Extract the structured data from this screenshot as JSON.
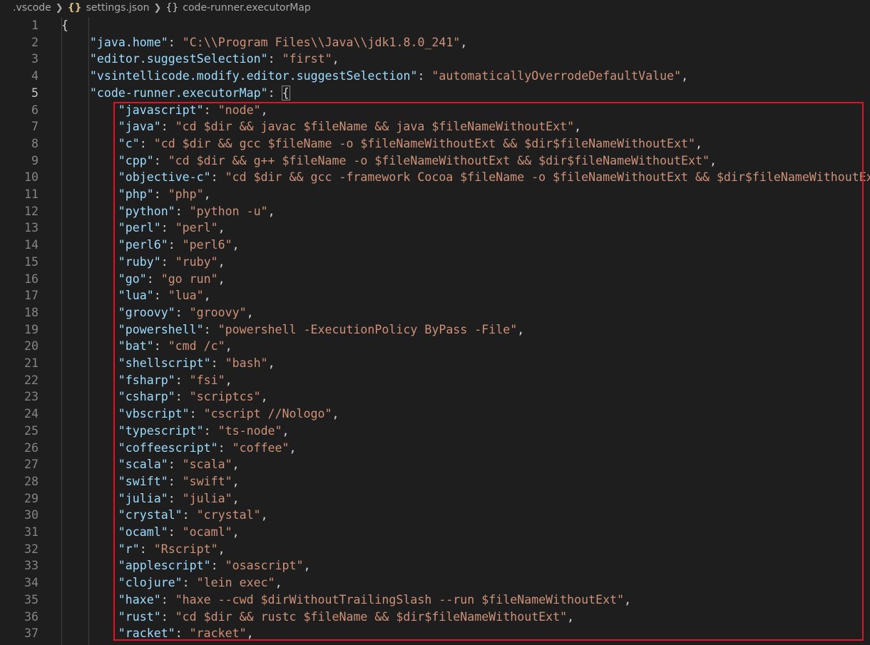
{
  "breadcrumb": {
    "folder": ".vscode",
    "file_icon": "{}",
    "file": "settings.json",
    "symbol_icon": "{}",
    "symbol": "code-runner.executorMap"
  },
  "editor": {
    "active_line": 5,
    "top_lines": [
      {
        "n": "1",
        "indent": 0,
        "text": "{"
      },
      {
        "n": "2",
        "indent": 1,
        "key": "\"java.home\"",
        "value": "\"C:\\\\Program Files\\\\Java\\\\jdk1.8.0_241\"",
        "tail": ","
      },
      {
        "n": "3",
        "indent": 1,
        "key": "\"editor.suggestSelection\"",
        "value": "\"first\"",
        "tail": ","
      },
      {
        "n": "4",
        "indent": 1,
        "key": "\"vsintellicode.modify.editor.suggestSelection\"",
        "value": "\"automaticallyOverrodeDefaultValue\"",
        "tail": ","
      },
      {
        "n": "5",
        "indent": 1,
        "key": "\"code-runner.executorMap\"",
        "open": "{"
      }
    ],
    "map_lines": [
      {
        "n": "6",
        "key": "\"javascript\"",
        "value": "\"node\""
      },
      {
        "n": "7",
        "key": "\"java\"",
        "value": "\"cd $dir && javac $fileName && java $fileNameWithoutExt\""
      },
      {
        "n": "8",
        "key": "\"c\"",
        "value": "\"cd $dir && gcc $fileName -o $fileNameWithoutExt && $dir$fileNameWithoutExt\""
      },
      {
        "n": "9",
        "key": "\"cpp\"",
        "value": "\"cd $dir && g++ $fileName -o $fileNameWithoutExt && $dir$fileNameWithoutExt\""
      },
      {
        "n": "10",
        "key": "\"objective-c\"",
        "value": "\"cd $dir && gcc -framework Cocoa $fileName -o $fileNameWithoutExt && $dir$fileNameWithoutExt\""
      },
      {
        "n": "11",
        "key": "\"php\"",
        "value": "\"php\""
      },
      {
        "n": "12",
        "key": "\"python\"",
        "value": "\"python -u\""
      },
      {
        "n": "13",
        "key": "\"perl\"",
        "value": "\"perl\""
      },
      {
        "n": "14",
        "key": "\"perl6\"",
        "value": "\"perl6\""
      },
      {
        "n": "15",
        "key": "\"ruby\"",
        "value": "\"ruby\""
      },
      {
        "n": "16",
        "key": "\"go\"",
        "value": "\"go run\""
      },
      {
        "n": "17",
        "key": "\"lua\"",
        "value": "\"lua\""
      },
      {
        "n": "18",
        "key": "\"groovy\"",
        "value": "\"groovy\""
      },
      {
        "n": "19",
        "key": "\"powershell\"",
        "value": "\"powershell -ExecutionPolicy ByPass -File\""
      },
      {
        "n": "20",
        "key": "\"bat\"",
        "value": "\"cmd /c\""
      },
      {
        "n": "21",
        "key": "\"shellscript\"",
        "value": "\"bash\""
      },
      {
        "n": "22",
        "key": "\"fsharp\"",
        "value": "\"fsi\""
      },
      {
        "n": "23",
        "key": "\"csharp\"",
        "value": "\"scriptcs\""
      },
      {
        "n": "24",
        "key": "\"vbscript\"",
        "value": "\"cscript //Nologo\""
      },
      {
        "n": "25",
        "key": "\"typescript\"",
        "value": "\"ts-node\""
      },
      {
        "n": "26",
        "key": "\"coffeescript\"",
        "value": "\"coffee\""
      },
      {
        "n": "27",
        "key": "\"scala\"",
        "value": "\"scala\""
      },
      {
        "n": "28",
        "key": "\"swift\"",
        "value": "\"swift\""
      },
      {
        "n": "29",
        "key": "\"julia\"",
        "value": "\"julia\""
      },
      {
        "n": "30",
        "key": "\"crystal\"",
        "value": "\"crystal\""
      },
      {
        "n": "31",
        "key": "\"ocaml\"",
        "value": "\"ocaml\""
      },
      {
        "n": "32",
        "key": "\"r\"",
        "value": "\"Rscript\""
      },
      {
        "n": "33",
        "key": "\"applescript\"",
        "value": "\"osascript\""
      },
      {
        "n": "34",
        "key": "\"clojure\"",
        "value": "\"lein exec\""
      },
      {
        "n": "35",
        "key": "\"haxe\"",
        "value": "\"haxe --cwd $dirWithoutTrailingSlash --run $fileNameWithoutExt\""
      },
      {
        "n": "36",
        "key": "\"rust\"",
        "value": "\"cd $dir && rustc $fileName && $dir$fileNameWithoutExt\""
      },
      {
        "n": "37",
        "key": "\"racket\"",
        "value": "\"racket\""
      }
    ]
  },
  "colors": {
    "background": "#1e1e1e",
    "key": "#9cdcfe",
    "string": "#ce9178",
    "punctuation": "#d4d4d4",
    "line_number": "#858585",
    "highlight_box": "#e81123"
  }
}
